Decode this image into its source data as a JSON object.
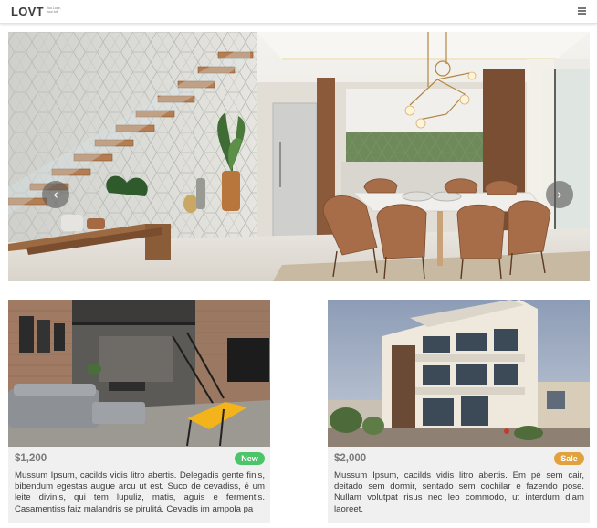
{
  "header": {
    "logo": "LOVT",
    "tagline": "You Love, your loft",
    "menu_icon": "hamburger-menu-icon"
  },
  "carousel": {
    "prev_icon": "chevron-left-icon",
    "prev_glyph": "‹",
    "next_icon": "chevron-right-icon",
    "next_glyph": "›"
  },
  "listings": [
    {
      "price": "$1,200",
      "badge": "New",
      "badge_color": "#4bc46a",
      "description": "Mussum Ipsum, cacilds vidis litro abertis. Delegadis gente finis, bibendum egestas augue arcu ut est. Suco de cevadiss, é um leite divinis, qui tem lupuliz, matis, aguis e fermentis. Casamentiss faiz malandris se pirulitá. Cevadis im ampola pa"
    },
    {
      "price": "$2,000",
      "badge": "Sale",
      "badge_color": "#e1a13c",
      "description": "Mussum Ipsum, cacilds vidis litro abertis. Em pé sem cair, deitado sem dormir, sentado sem cochilar e fazendo pose. Nullam volutpat risus nec leo commodo, ut interdum diam laoreet."
    }
  ]
}
